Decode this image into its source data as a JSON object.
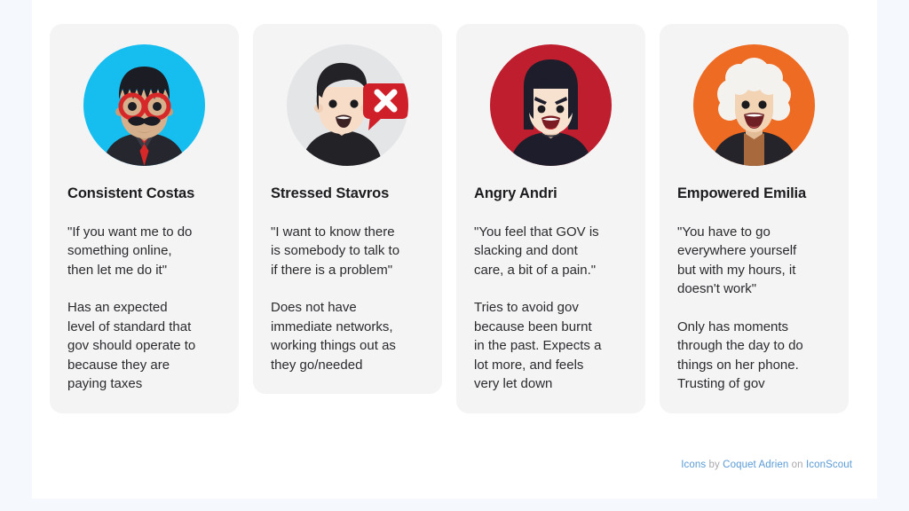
{
  "slide": {
    "background": "#ffffff",
    "page_background": "#f5f8fc",
    "card_background": "#f4f4f5"
  },
  "cards": [
    {
      "name": "Consistent Costas",
      "quote": "\"If you want me to do\nsomething online,\nthen let me do it\"",
      "description": "Has an expected\nlevel of standard that\ngov should operate to\nbecause they are\npaying taxes",
      "avatar": {
        "icon": "man-with-glasses-and-mustache-avatar",
        "circle_color": "#16bef0",
        "hair_color": "#1c1c24",
        "skin_color": "#d6b08c",
        "accent_color": "#d62828"
      }
    },
    {
      "name": "Stressed Stavros",
      "quote": "\"I want to know there\nis somebody to talk to\nif there is a problem\"",
      "description": "Does not have\nimmediate networks,\nworking things out as\nthey go/needed",
      "avatar": {
        "icon": "worried-man-with-error-speech-bubble-avatar",
        "circle_color": "#e4e5e7",
        "hair_color": "#222227",
        "skin_color": "#f7ddc8",
        "accent_color": "#cf2029"
      }
    },
    {
      "name": "Angry Andri",
      "quote": "\"You feel that GOV is\nslacking and dont\ncare, a bit of a pain.\"",
      "description": "Tries to avoid gov\nbecause been burnt\nin the past. Expects a\nlot more, and feels\nvery let down",
      "avatar": {
        "icon": "angry-woman-avatar",
        "circle_color": "#be1e2d",
        "hair_color": "#1d1d2b",
        "skin_color": "#f7e2d0",
        "accent_color": "#d23b3b"
      }
    },
    {
      "name": "Empowered Emilia",
      "quote": "\"You have to go\neverywhere yourself\nbut with my hours, it\ndoesn't work\"",
      "description": "Only has moments\nthrough the day to do\nthings on her phone.\nTrusting of gov",
      "avatar": {
        "icon": "smiling-elderly-woman-avatar",
        "circle_color": "#ed6b23",
        "hair_color": "#f4f2ef",
        "skin_color": "#f2d3b4",
        "accent_color": "#a86a3d"
      }
    }
  ],
  "attribution": {
    "word_icons": "Icons",
    "word_by": "by",
    "author": "Coquet Adrien",
    "word_on": "on",
    "site": "IconScout",
    "link_color": "#5b9bd5",
    "text_color": "#a9a9ad"
  }
}
